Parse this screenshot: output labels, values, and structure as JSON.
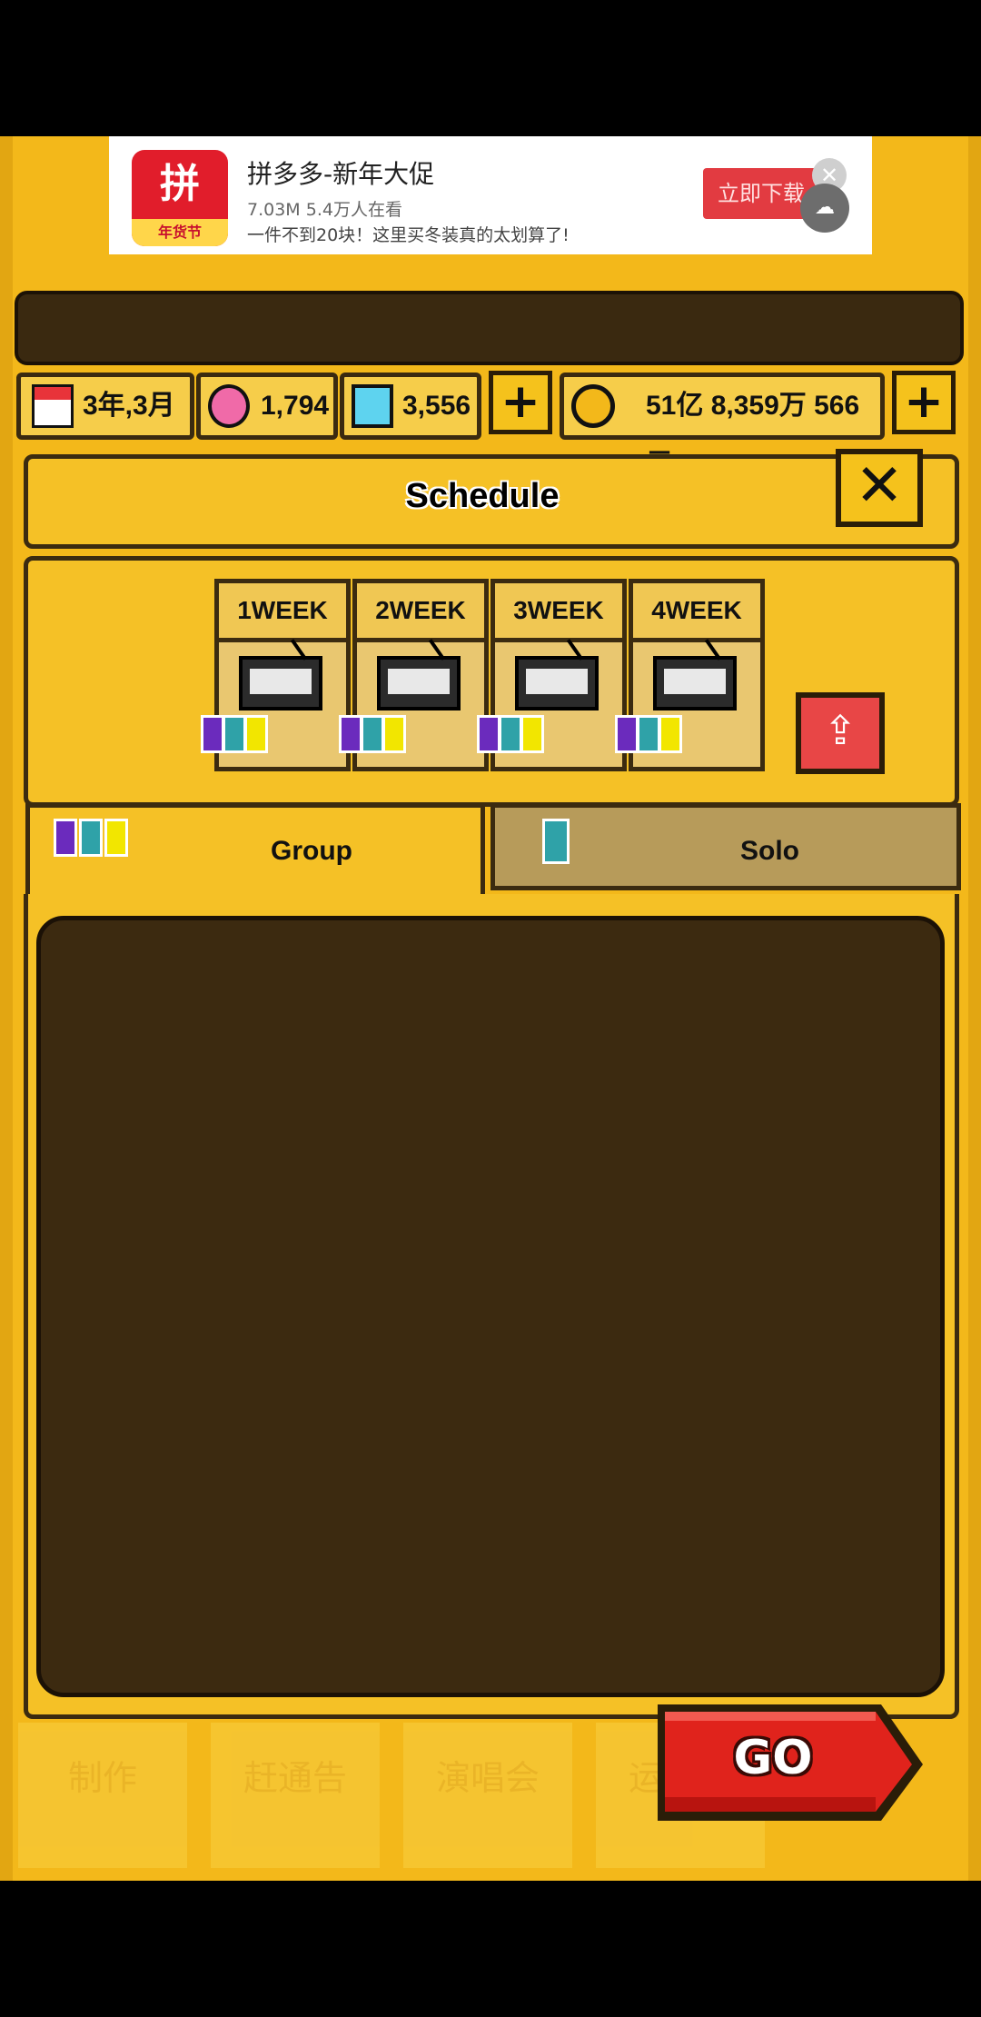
{
  "ad": {
    "title": "拼多多-新年大促",
    "subtitle": "7.03M 5.4万人在看",
    "description": "一件不到20块！这里买冬装真的太划算了!",
    "button": "立即下载",
    "logo_text": "拼",
    "logo_strip": "年货节",
    "close": "✕"
  },
  "resources": {
    "date": "3年,3月",
    "hearts": "1,794",
    "diamonds": "3,556",
    "money": "51亿 8,359万 566元"
  },
  "schedule": {
    "title": "Schedule",
    "weeks": [
      "1WEEK",
      "2WEEK",
      "3WEEK",
      "4WEEK"
    ]
  },
  "tabs": {
    "group": "Group",
    "solo": "Solo"
  },
  "bottom_nav": [
    "制作",
    "赶通告",
    "演唱会",
    "运"
  ],
  "go_button": "GO",
  "icons": {
    "calendar": "calendar-icon",
    "heart_gem": "pink-gem-icon",
    "diamond": "diamond-icon",
    "coin": "coin-icon",
    "plus": "plus-icon",
    "close": "close-icon",
    "tv": "tv-icon",
    "upload": "upload-icon"
  },
  "colors": {
    "game_bg": "#f3b81a",
    "panel": "#f5c126",
    "dark": "#3c2a10",
    "go_red": "#e0231c"
  }
}
